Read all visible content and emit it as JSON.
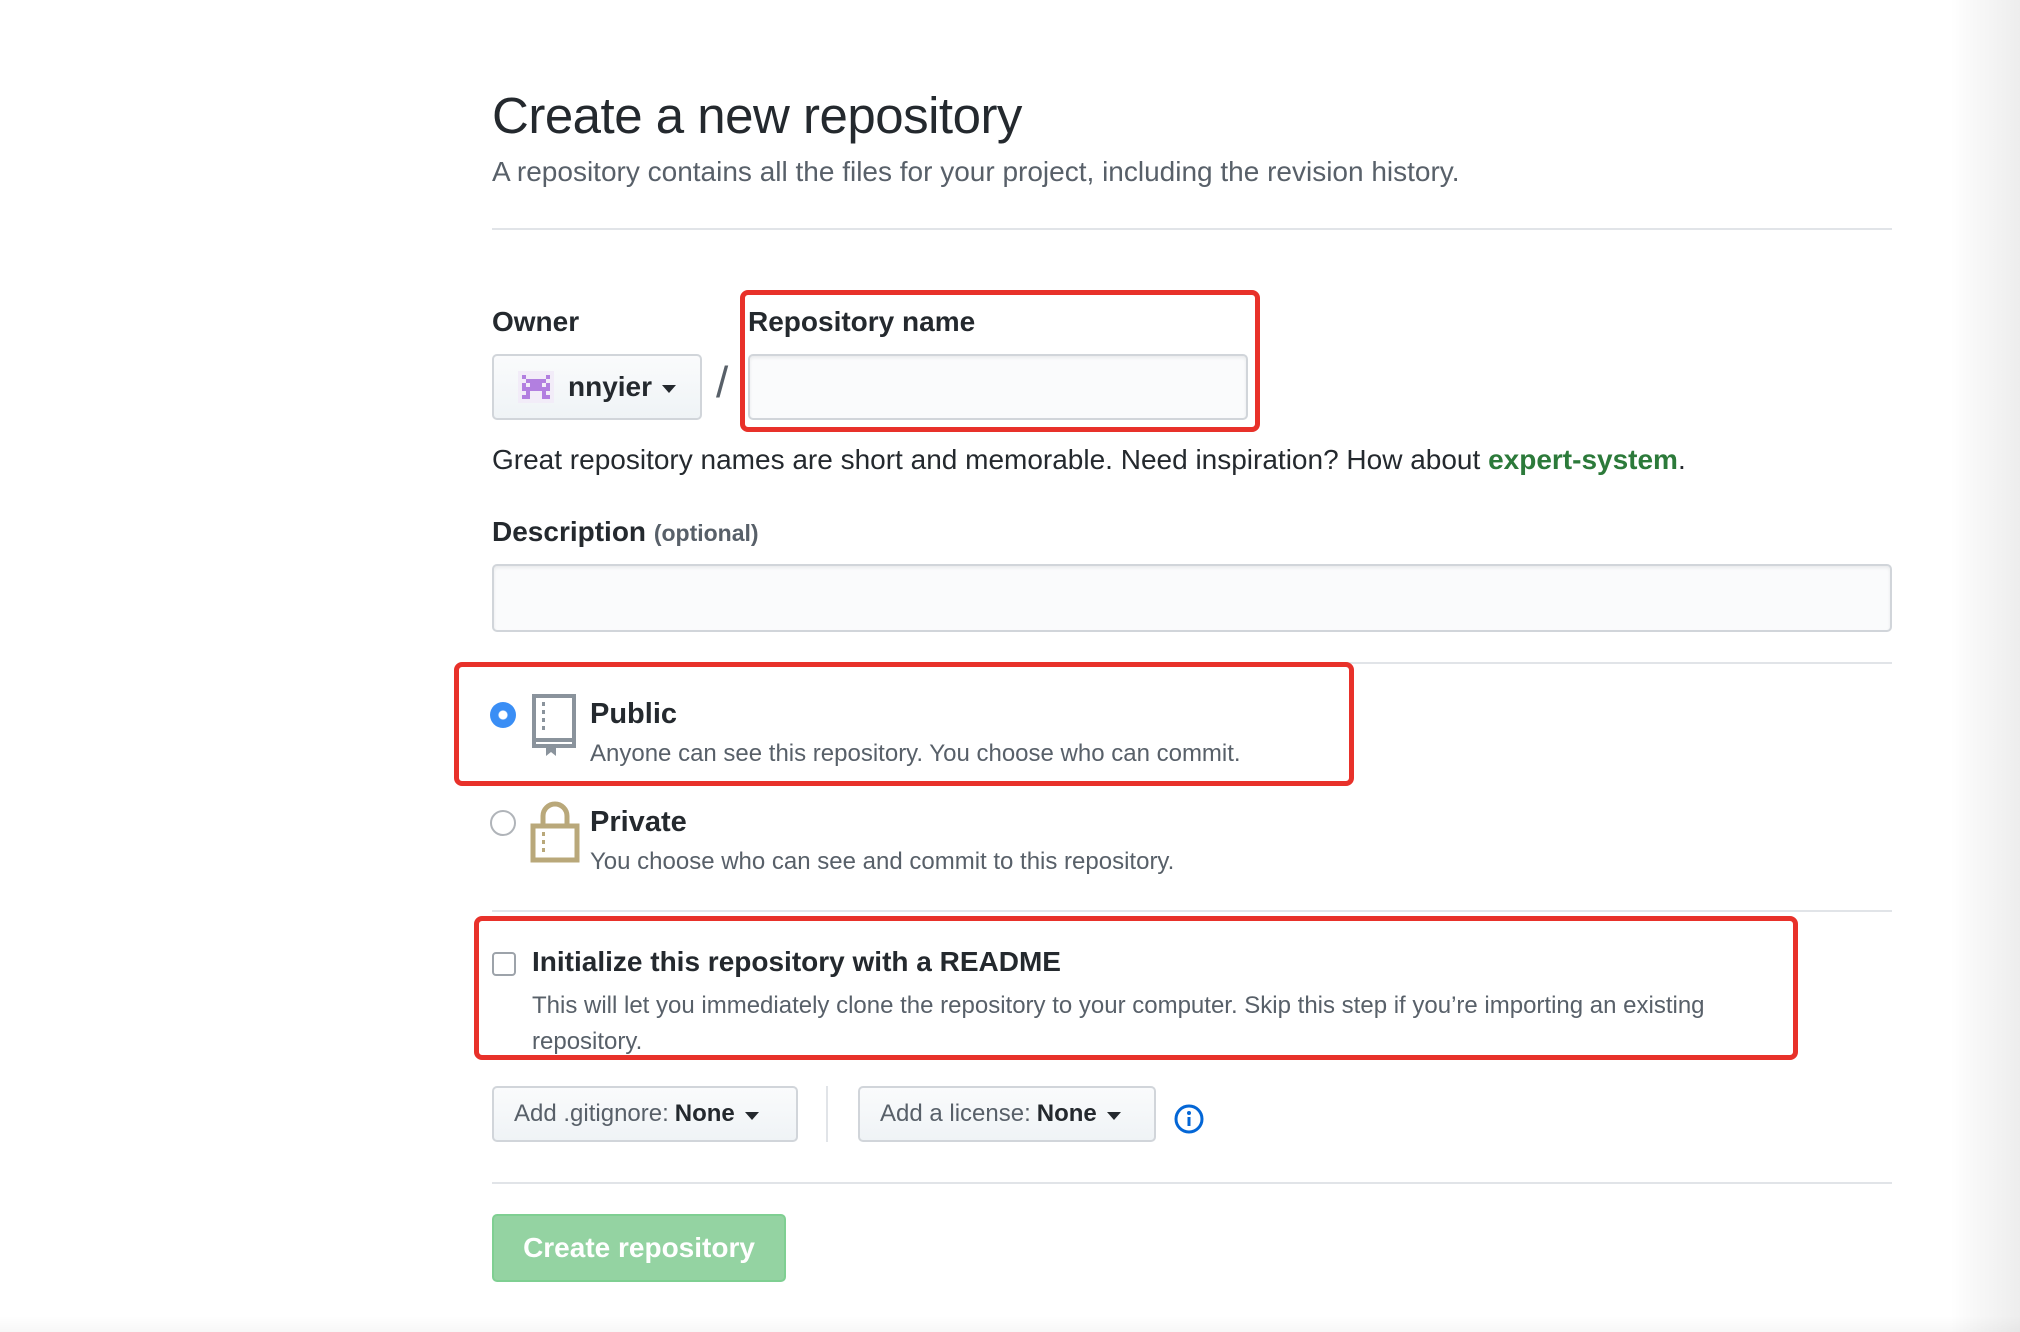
{
  "header": {
    "title": "Create a new repository",
    "subtitle": "A repository contains all the files for your project, including the revision history."
  },
  "owner": {
    "label": "Owner",
    "value": "nnyier",
    "avatar_icon": "identicon-avatar"
  },
  "separator": "/",
  "repo_name": {
    "label": "Repository name",
    "value": "",
    "placeholder": ""
  },
  "hint": {
    "text": "Great repository names are short and memorable. Need inspiration? How about ",
    "suggestion": "expert-system",
    "end": "."
  },
  "description": {
    "label": "Description",
    "optional": "(optional)",
    "value": "",
    "placeholder": ""
  },
  "visibility": {
    "public": {
      "title": "Public",
      "desc": "Anyone can see this repository. You choose who can commit.",
      "selected": true,
      "icon": "repo-book-icon"
    },
    "private": {
      "title": "Private",
      "desc": "You choose who can see and commit to this repository.",
      "selected": false,
      "icon": "lock-icon"
    }
  },
  "readme": {
    "title": "Initialize this repository with a README",
    "desc": "This will let you immediately clone the repository to your computer. Skip this step if you’re importing an existing repository.",
    "checked": false
  },
  "gitignore": {
    "label": "Add .gitignore:",
    "value": "None"
  },
  "license": {
    "label": "Add a license:",
    "value": "None"
  },
  "submit": {
    "label": "Create repository",
    "enabled": false
  },
  "colors": {
    "accent_blue": "#3a8ef5",
    "suggestion_green": "#2c7a3a",
    "button_green_disabled": "#94d3a2",
    "annotation_red": "#e8312a"
  }
}
